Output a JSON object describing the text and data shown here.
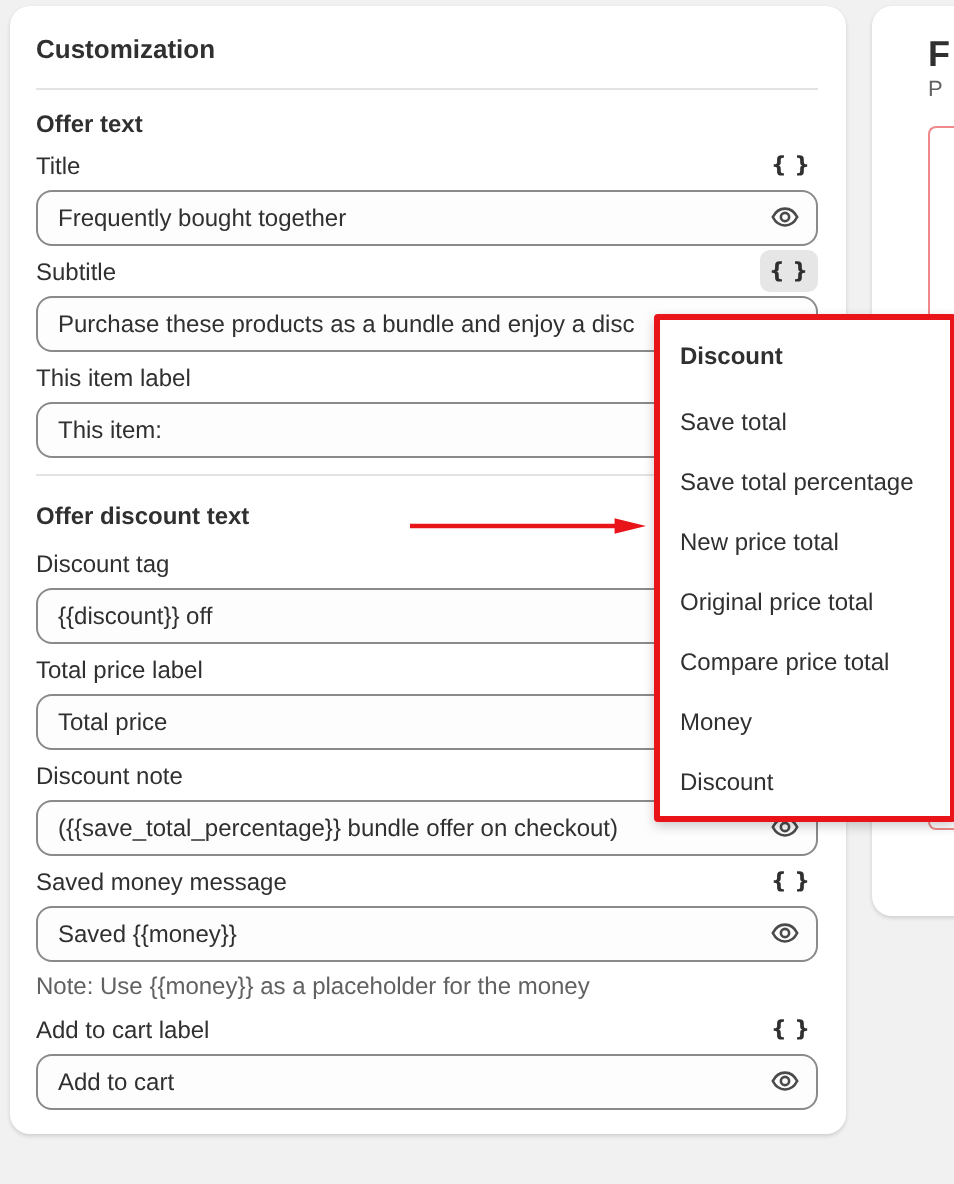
{
  "panel": {
    "title": "Customization",
    "sections": [
      {
        "heading": "Offer text",
        "fields": [
          {
            "label": "Title",
            "value": "Frequently bought together",
            "braces": "{ }",
            "braces_active": false,
            "eye": true
          },
          {
            "label": "Subtitle",
            "value": "Purchase these products as a bundle and enjoy a disc",
            "braces": "{ }",
            "braces_active": true
          },
          {
            "label": "This item label",
            "value": "This item:"
          }
        ]
      },
      {
        "heading": "Offer discount text",
        "fields": [
          {
            "label": "Discount tag",
            "value": "{{discount}} off"
          },
          {
            "label": "Total price label",
            "value": "Total price"
          },
          {
            "label": "Discount note",
            "value": "({{save_total_percentage}} bundle offer on checkout)",
            "eye": true
          },
          {
            "label": "Saved money message",
            "value": "Saved {{money}}",
            "braces": "{ }",
            "braces_active": false,
            "eye": true,
            "note": "Note: Use {{money}} as a placeholder for the money"
          },
          {
            "label": "Add to cart label",
            "value": "Add to cart",
            "braces": "{ }",
            "braces_active": false,
            "eye": true
          }
        ]
      }
    ]
  },
  "variable_menu": {
    "heading": "Discount",
    "items": [
      "Save total",
      "Save total percentage",
      "New price total",
      "Original price total",
      "Compare price total",
      "Money",
      "Discount"
    ]
  },
  "preview": {
    "title": "F",
    "subtitle": "P"
  }
}
